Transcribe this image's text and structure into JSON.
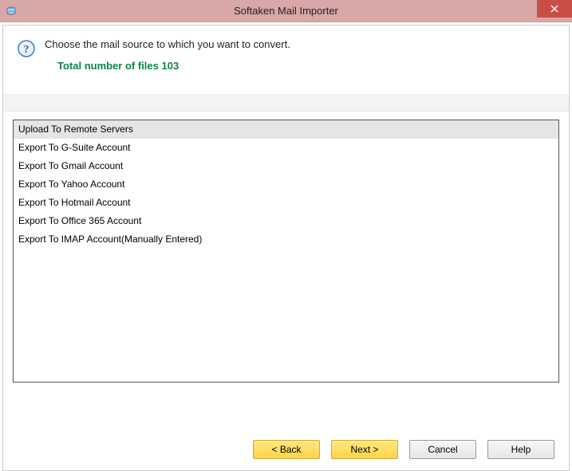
{
  "window": {
    "title": "Softaken Mail Importer"
  },
  "header": {
    "instruction": "Choose the mail source to which you want to convert.",
    "file_count_text": "Total number of files 103"
  },
  "list": {
    "header": "Upload To Remote Servers",
    "items": [
      "Export To G-Suite Account",
      "Export To Gmail Account",
      "Export To Yahoo Account",
      "Export To Hotmail Account",
      "Export To Office 365 Account",
      "Export To IMAP Account(Manually Entered)"
    ]
  },
  "buttons": {
    "back": "< Back",
    "next": "Next >",
    "cancel": "Cancel",
    "help": "Help"
  }
}
